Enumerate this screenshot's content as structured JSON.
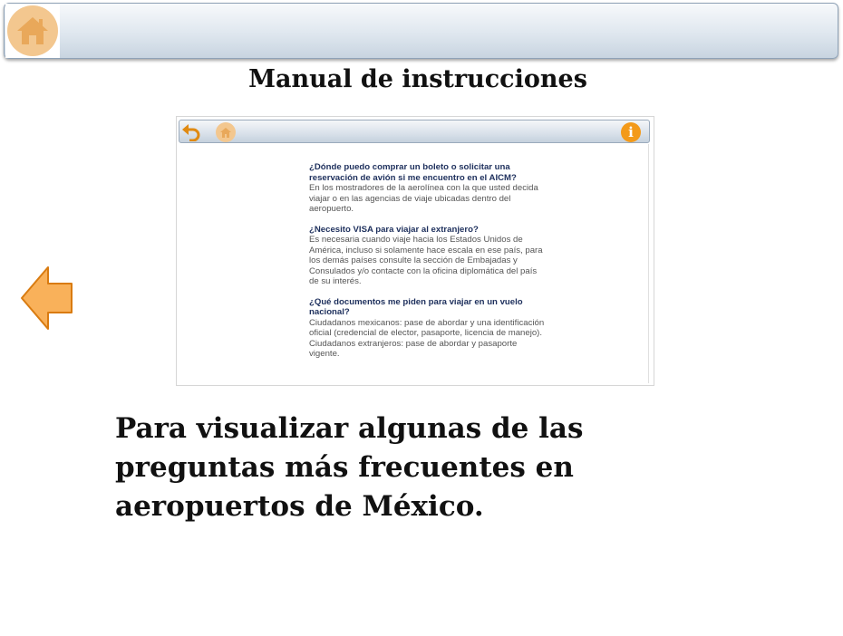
{
  "header": {
    "home_icon": "home-icon"
  },
  "title": "Manual de instrucciones",
  "screenshot": {
    "toolbar": {
      "back_icon": "undo-arrow-icon",
      "home_icon": "home-icon",
      "info_icon": "info-icon",
      "info_glyph": "i"
    },
    "faq": [
      {
        "question": "¿Dónde puedo comprar un boleto o solicitar una reservación de avión si me encuentro en el AICM?",
        "answer": "En los mostradores de la aerolínea con la que usted decida viajar o en las agencias de viaje ubicadas dentro del aeropuerto."
      },
      {
        "question": "¿Necesito VISA para viajar al extranjero?",
        "answer": "Es necesaria cuando viaje hacia los Estados Unidos de América, incluso si solamente hace escala en ese país, para los demás países consulte la sección de Embajadas y Consulados y/o contacte con la oficina diplomática del país de su interés."
      },
      {
        "question": "¿Qué documentos me piden para viajar en un vuelo nacional?",
        "answer": "Ciudadanos mexicanos: pase de abordar y una identificación oficial (credencial de elector, pasaporte, licencia de manejo). Ciudadanos extranjeros: pase de abordar y pasaporte vigente."
      }
    ]
  },
  "navigation": {
    "prev_icon": "left-arrow-icon"
  },
  "description": "Para visualizar algunas de las preguntas más frecuentes en aeropuertos de México.",
  "colors": {
    "accent_orange": "#f39a1a",
    "home_orange": "#f3c78f",
    "faq_question": "#1d2f5c"
  }
}
